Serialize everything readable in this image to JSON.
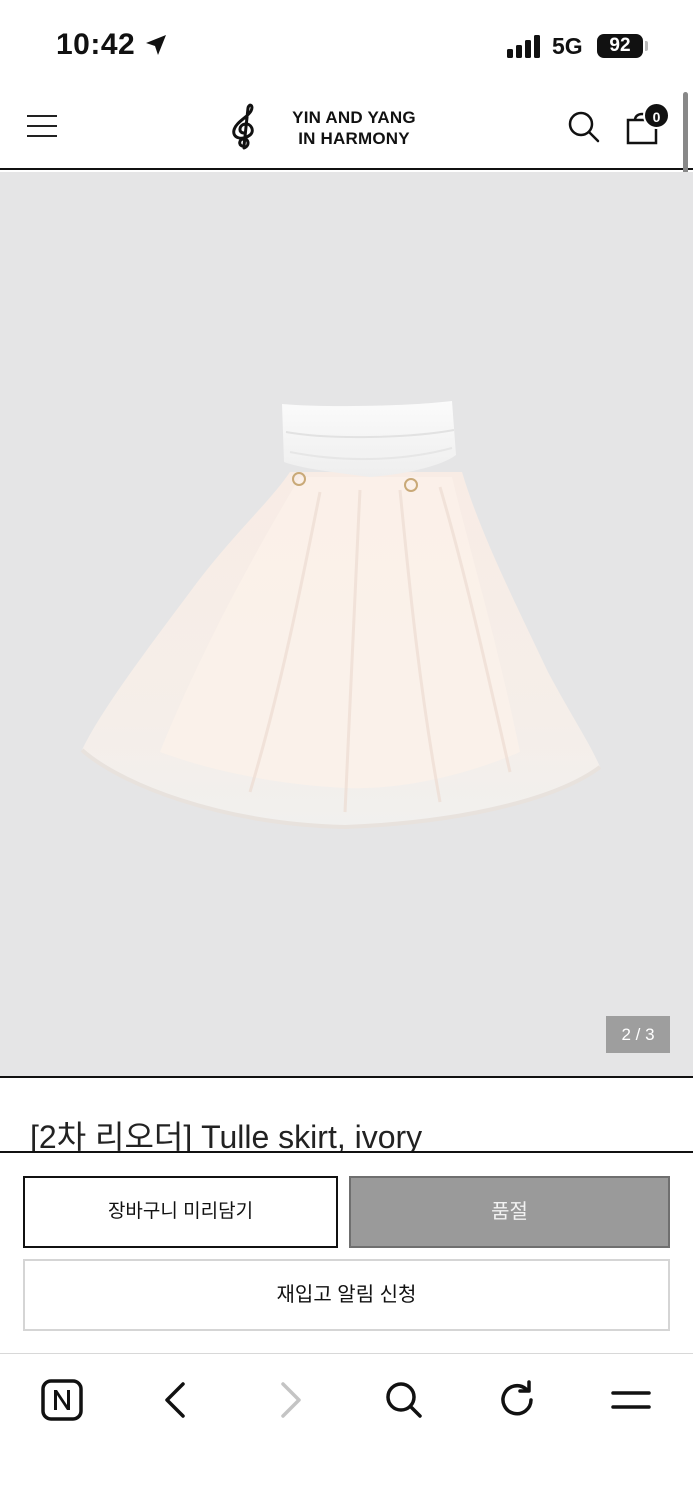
{
  "status_bar": {
    "time": "10:42",
    "network": "5G",
    "battery": "92"
  },
  "header": {
    "logo_line1": "YIN AND YANG",
    "logo_line2": "IN HARMONY",
    "cart_count": "0"
  },
  "product": {
    "image_counter": "2 / 3",
    "title": "[2차 리오더] Tulle skirt, ivory"
  },
  "actions": {
    "add_to_cart_label": "장바구니 미리담기",
    "sold_out_label": "품절",
    "restock_alert_label": "재입고 알림 신청"
  },
  "toolbar": {
    "icons": [
      "naver-n-icon",
      "back-arrow-icon",
      "forward-arrow-icon",
      "search-icon",
      "reload-icon",
      "menu-icon"
    ]
  },
  "colors": {
    "image_background": "#e5e5e6",
    "sold_out_button": "#9a9a9a",
    "text": "#111111"
  }
}
